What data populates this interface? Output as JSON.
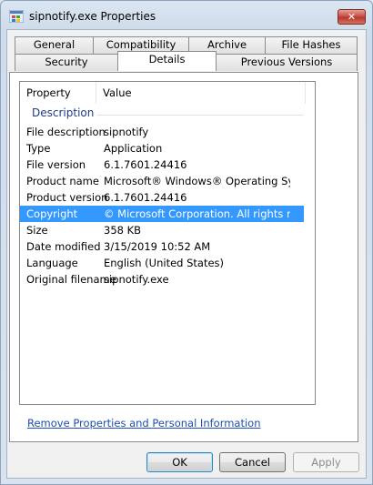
{
  "window": {
    "title": "sipnotify.exe Properties",
    "close_glyph": "✕"
  },
  "tabs_row1": [
    {
      "label": "General"
    },
    {
      "label": "Compatibility"
    },
    {
      "label": "Archive"
    },
    {
      "label": "File Hashes"
    }
  ],
  "tabs_row2": [
    {
      "label": "Security"
    },
    {
      "label": "Details"
    },
    {
      "label": "Previous Versions"
    }
  ],
  "details": {
    "col_property": "Property",
    "col_value": "Value",
    "group": "Description",
    "rows": [
      {
        "property": "File description",
        "value": "sipnotify"
      },
      {
        "property": "Type",
        "value": "Application"
      },
      {
        "property": "File version",
        "value": "6.1.7601.24416"
      },
      {
        "property": "Product name",
        "value": "Microsoft® Windows® Operating System"
      },
      {
        "property": "Product version",
        "value": "6.1.7601.24416"
      },
      {
        "property": "Copyright",
        "value": "© Microsoft Corporation. All rights reserv..."
      },
      {
        "property": "Size",
        "value": "358 KB"
      },
      {
        "property": "Date modified",
        "value": "3/15/2019 10:52 AM"
      },
      {
        "property": "Language",
        "value": "English (United States)"
      },
      {
        "property": "Original filename",
        "value": "sipnotify.exe"
      }
    ],
    "selected_index": 5
  },
  "remove_link": "Remove Properties and Personal Information",
  "buttons": {
    "ok": "OK",
    "cancel": "Cancel",
    "apply": "Apply"
  }
}
